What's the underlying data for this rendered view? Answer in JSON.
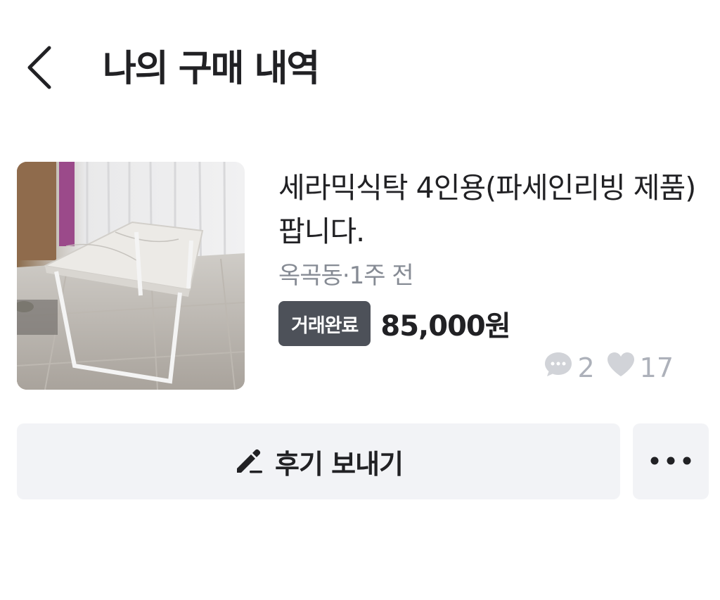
{
  "header": {
    "back_icon": "chevron-left-icon",
    "title": "나의 구매 내역"
  },
  "item": {
    "title": "세라믹식탁 4인용(파세인리빙 제품) 팝니다.",
    "location": "옥곡동",
    "separator": "·",
    "time": "1주 전",
    "status": "거래완료",
    "price": "85,000원",
    "chat_count": "2",
    "like_count": "17",
    "chat_icon": "chat-bubble-icon",
    "like_icon": "heart-icon"
  },
  "actions": {
    "review_icon": "pencil-icon",
    "review_label": "후기 보내기",
    "more_icon": "more-horizontal-icon"
  },
  "colors": {
    "badge_bg": "#4d5159",
    "button_bg": "#f2f3f6",
    "muted_text": "#868b94",
    "count_text": "#adb1ba"
  }
}
